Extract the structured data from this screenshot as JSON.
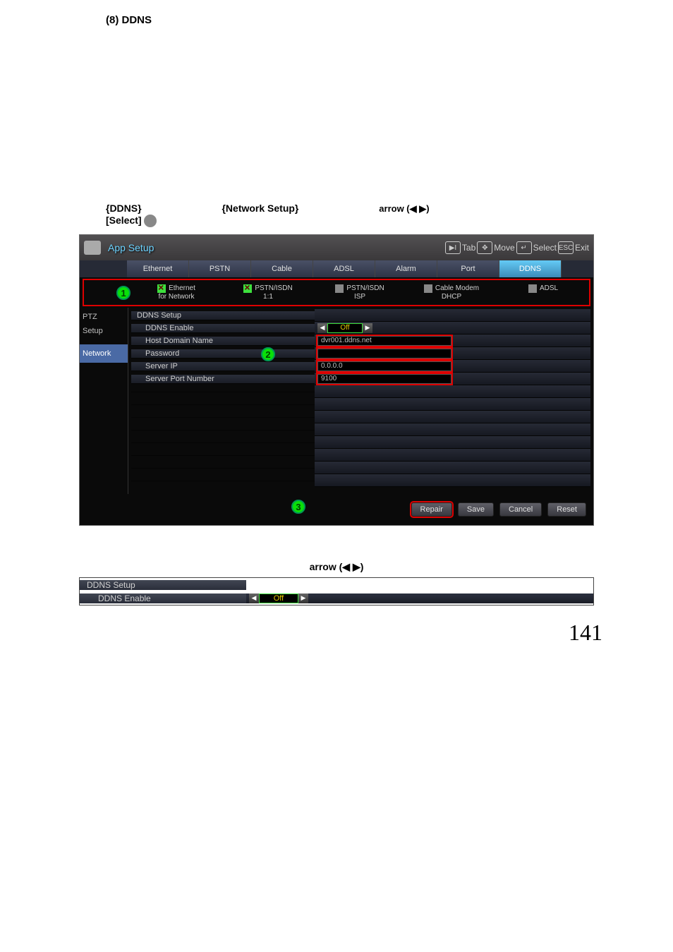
{
  "page_heading": "(8) DDNS",
  "intro": {
    "ddns": "{DDNS}",
    "netsetup": "{Network Setup}",
    "arrow": "arrow (◀ ▶)",
    "select": "[Select]"
  },
  "title": "App Setup",
  "nav": {
    "tab": "Tab",
    "move": "Move",
    "select": "Select",
    "exit": "Exit",
    "tab_icon": "▶I",
    "esc": "ESC"
  },
  "tabs": [
    "Ethernet",
    "PSTN",
    "Cable",
    "ADSL",
    "Alarm",
    "Port",
    "DDNS"
  ],
  "conn": [
    {
      "checked": true,
      "line1": "Ethernet",
      "line2": "for Network"
    },
    {
      "checked": true,
      "line1": "PSTN/ISDN",
      "line2": "1:1"
    },
    {
      "checked": false,
      "line1": "PSTN/ISDN",
      "line2": "ISP"
    },
    {
      "checked": false,
      "line1": "Cable Modem",
      "line2": "DHCP"
    },
    {
      "checked": false,
      "line1": "ADSL",
      "line2": ""
    }
  ],
  "side": {
    "ptz": "PTZ",
    "setup": "Setup",
    "network": "Network"
  },
  "ddns": {
    "title": "DDNS Setup",
    "enable_label": "DDNS Enable",
    "enable_val": "Off",
    "host_label": "Host Domain Name",
    "host_val": "dvr001.ddns.net",
    "pass_label": "Password",
    "pass_val": "",
    "ip_label": "Server IP",
    "ip_val": "0.0.0.0",
    "port_label": "Server Port Number",
    "port_val": "9100"
  },
  "buttons": {
    "repair": "Repair",
    "save": "Save",
    "cancel": "Cancel",
    "reset": "Reset"
  },
  "second_caption": "arrow (◀ ▶)",
  "sp": {
    "title": "DDNS Setup",
    "label": "DDNS Enable",
    "val": "Off"
  },
  "page_num": "141"
}
